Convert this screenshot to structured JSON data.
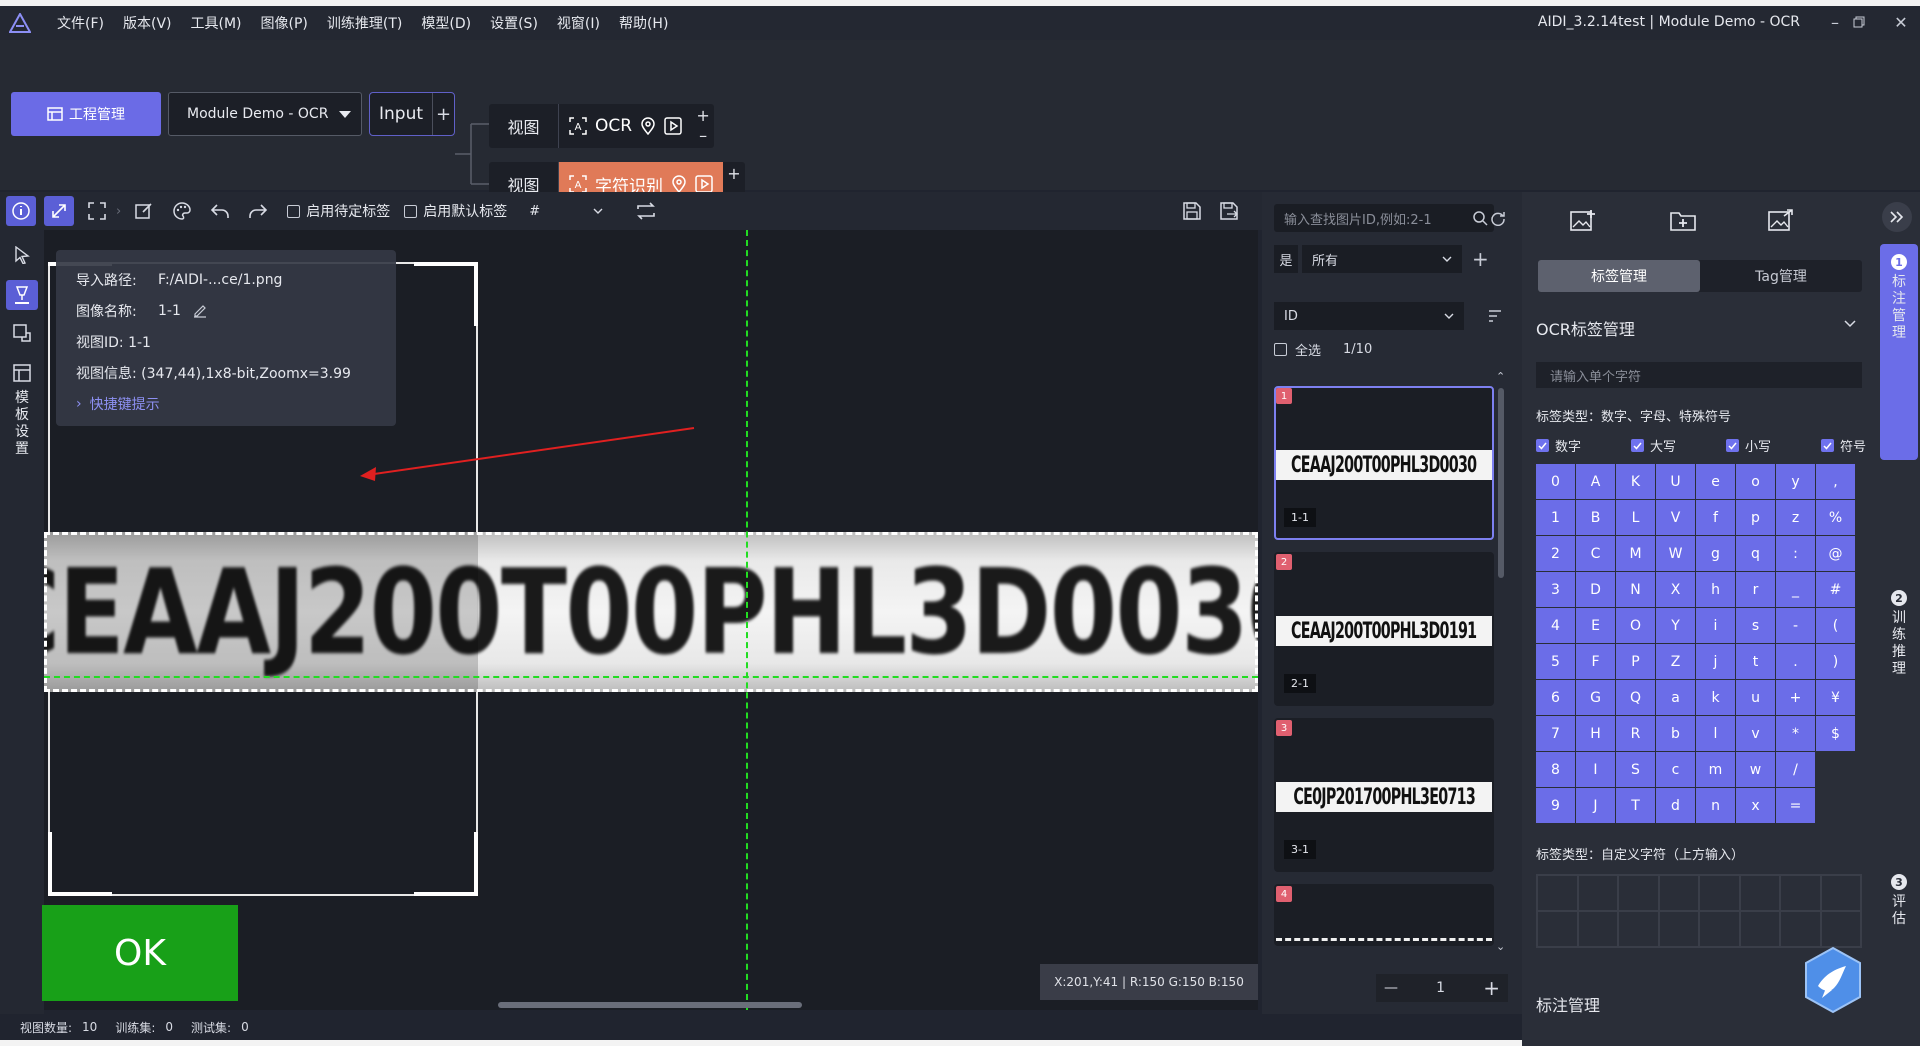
{
  "menu": {
    "items": [
      "文件(F)",
      "版本(V)",
      "工具(M)",
      "图像(P)",
      "训练推理(T)",
      "模型(D)",
      "设置(S)",
      "视窗(I)",
      "帮助(H)"
    ],
    "window_title": "AIDI_3.2.14test | Module Demo - OCR"
  },
  "workflow": {
    "project_btn": "工程管理",
    "module_select": "Module Demo - OCR",
    "input_node": "Input",
    "node1": {
      "view": "视图",
      "op": "OCR"
    },
    "node2": {
      "view": "视图",
      "op": "字符识别"
    }
  },
  "toolbar": {
    "pending_label": "启用待定标签",
    "default_label": "启用默认标签",
    "tag_select": "#"
  },
  "left_tools": {
    "template_settings": "模板设置"
  },
  "canvas": {
    "image_text": "CEAAJ200T00PHL3D0030",
    "info": {
      "import_path_key": "导入路径:",
      "import_path_val": "F:/AIDI-...ce/1.png",
      "image_name_key": "图像名称:",
      "image_name_val": "1-1",
      "view_id": "视图ID: 1-1",
      "view_info": "视图信息: (347,44),1x8-bit,Zoomx=3.99",
      "hotkey": "快捷键提示"
    },
    "ok_label": "OK",
    "pixel_info": "X:201,Y:41 | R:150 G:150 B:150"
  },
  "statusbar": {
    "view_count_label": "视图数量:",
    "view_count": "10",
    "train_label": "训练集:",
    "train": "0",
    "test_label": "测试集:",
    "test": "0"
  },
  "image_list": {
    "search_placeholder": "输入查找图片ID,例如:2-1",
    "filter_yes": "是",
    "filter_all": "所有",
    "sort": "ID",
    "select_all": "全选",
    "selection": "1/10",
    "thumbs": [
      {
        "num": "1",
        "text": "CEAAJ200T00PHL3D0030",
        "id": "1-1"
      },
      {
        "num": "2",
        "text": "CEAAJ200T00PHL3D0191",
        "id": "2-1"
      },
      {
        "num": "3",
        "text": "CE0JP201700PHL3E0713",
        "id": "3-1"
      },
      {
        "num": "4",
        "text": "",
        "id": ""
      }
    ],
    "page": "1"
  },
  "label_panel": {
    "tabs": [
      "标签管理",
      "Tag管理"
    ],
    "ocr_title": "OCR标签管理",
    "char_placeholder": "请输入单个字符",
    "label_type": "标签类型：数字、字母、特殊符号",
    "checks": [
      "数字",
      "大写",
      "小写",
      "符号"
    ],
    "chars": [
      "0",
      "A",
      "K",
      "U",
      "e",
      "o",
      "y",
      ",",
      "1",
      "B",
      "L",
      "V",
      "f",
      "p",
      "z",
      "%",
      "2",
      "C",
      "M",
      "W",
      "g",
      "q",
      ":",
      "@",
      "3",
      "D",
      "N",
      "X",
      "h",
      "r",
      "_",
      "#",
      "4",
      "E",
      "O",
      "Y",
      "i",
      "s",
      "-",
      "(",
      "5",
      "F",
      "P",
      "Z",
      "j",
      "t",
      ".",
      ")",
      "6",
      "G",
      "Q",
      "a",
      "k",
      "u",
      "+",
      "¥",
      "7",
      "H",
      "R",
      "b",
      "l",
      "v",
      "*",
      "$",
      "8",
      "I",
      "S",
      "c",
      "m",
      "w",
      "/",
      "",
      "9",
      "J",
      "T",
      "d",
      "n",
      "x",
      "=",
      ""
    ],
    "custom_type": "标签类型：自定义字符（上方输入）",
    "bottom_title": "标注管理"
  },
  "rail": {
    "steps": [
      {
        "num": "1",
        "label": "标注管理"
      },
      {
        "num": "2",
        "label": "训练推理"
      },
      {
        "num": "3",
        "label": "评估"
      }
    ]
  },
  "colors": {
    "accent": "#6b6de8",
    "node_active": "#e07a58",
    "ok": "#18a018",
    "guide": "#22dd22",
    "arrow": "#e02020"
  }
}
